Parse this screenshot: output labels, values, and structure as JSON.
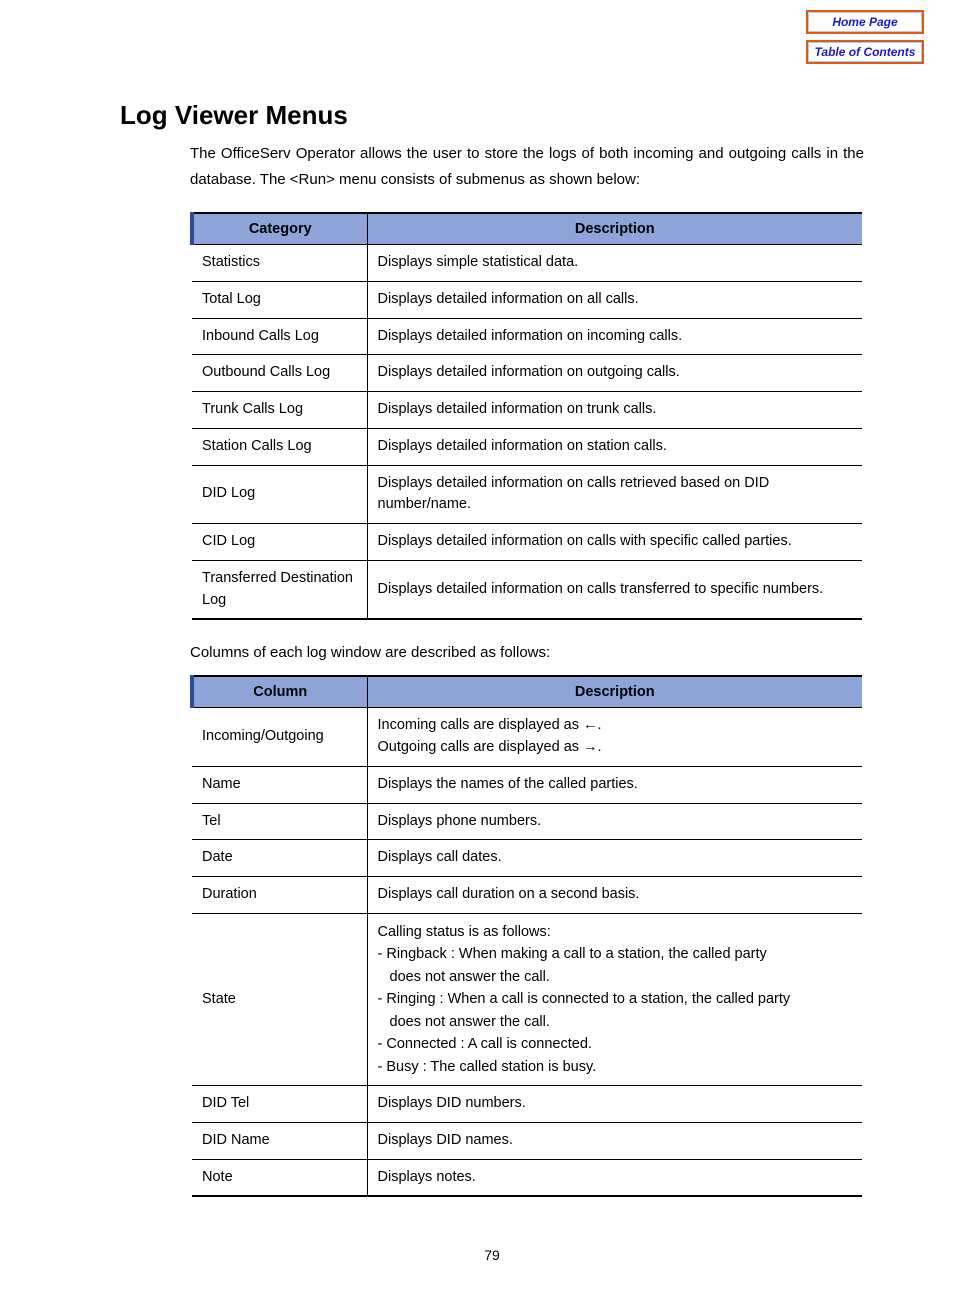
{
  "nav": {
    "home": "Home Page",
    "toc": "Table of Contents"
  },
  "title": "Log Viewer Menus",
  "intro": "The OfficeServ Operator allows the user to store the logs of both incoming and outgoing calls in the database. The <Run> menu consists of submenus as shown below:",
  "table1": {
    "headers": {
      "c1": "Category",
      "c2": "Description"
    },
    "rows": [
      {
        "c1": "Statistics",
        "c2": "Displays simple statistical data."
      },
      {
        "c1": "Total Log",
        "c2": "Displays detailed information on all calls."
      },
      {
        "c1": "Inbound Calls Log",
        "c2": "Displays detailed information on incoming calls."
      },
      {
        "c1": "Outbound Calls Log",
        "c2": "Displays detailed information on outgoing calls."
      },
      {
        "c1": "Trunk Calls Log",
        "c2": "Displays detailed information on trunk calls."
      },
      {
        "c1": "Station Calls Log",
        "c2": "Displays detailed information on station calls."
      },
      {
        "c1": "DID Log",
        "c2": "Displays detailed information on calls retrieved based on DID number/name."
      },
      {
        "c1": "CID Log",
        "c2": "Displays detailed information on calls with specific called parties."
      },
      {
        "c1": "Transferred Destination Log",
        "c2": "Displays detailed information on calls transferred to specific numbers."
      }
    ]
  },
  "midtext": "Columns of each log window are described as follows:",
  "table2": {
    "headers": {
      "c1": "Column",
      "c2": "Description"
    },
    "rows": [
      {
        "c1": "Incoming/Outgoing",
        "c2": "Incoming calls are displayed as ←.\nOutgoing calls are displayed as →."
      },
      {
        "c1": "Name",
        "c2": "Displays the names of the called parties."
      },
      {
        "c1": "Tel",
        "c2": "Displays phone numbers."
      },
      {
        "c1": "Date",
        "c2": "Displays call dates."
      },
      {
        "c1": "Duration",
        "c2": "Displays call duration on a second basis."
      },
      {
        "c1": "State",
        "state": {
          "l1": "Calling status is as follows:",
          "l2": "- Ringback : When making a call to a station, the called party",
          "l2b": "does not answer the call.",
          "l3": "- Ringing : When a call is connected to a station, the called party",
          "l3b": "does not answer the call.",
          "l4": "- Connected : A call is connected.",
          "l5": "- Busy : The called station is busy."
        }
      },
      {
        "c1": "DID Tel",
        "c2": "Displays DID numbers."
      },
      {
        "c1": "DID Name",
        "c2": "Displays DID names."
      },
      {
        "c1": "Note",
        "c2": "Displays notes."
      }
    ]
  },
  "pagenum": "79"
}
